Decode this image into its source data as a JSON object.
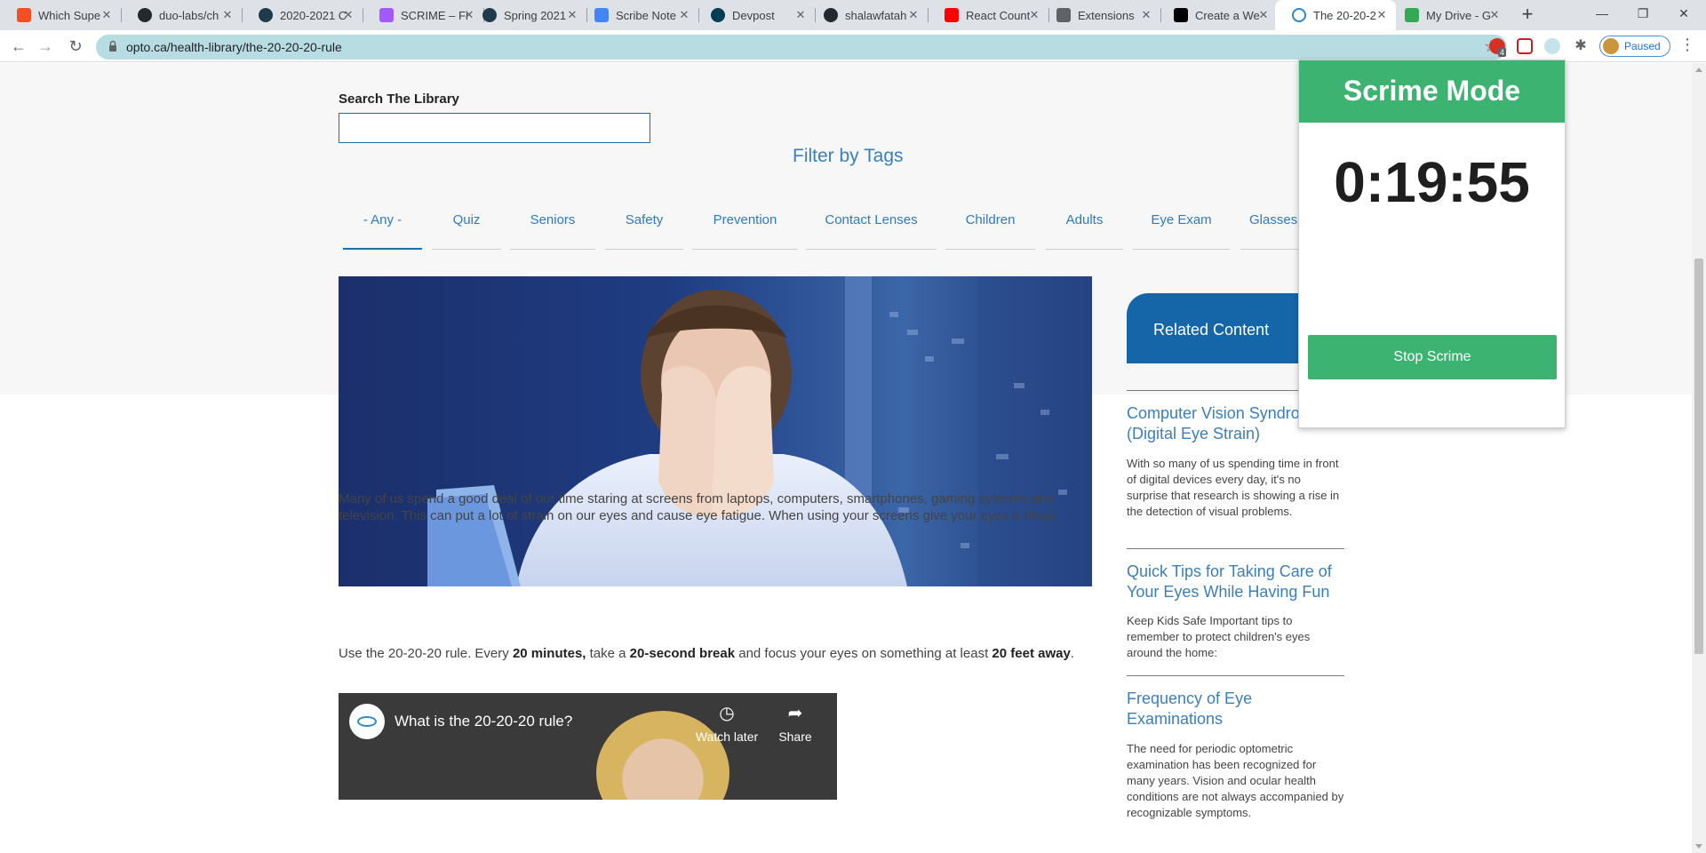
{
  "browser": {
    "tabs": [
      {
        "title": "Which Supe",
        "icon": "microsoft-icon",
        "color": "#f25022"
      },
      {
        "title": "duo-labs/ch",
        "icon": "github-icon",
        "color": "#24292e"
      },
      {
        "title": "2020-2021 C",
        "icon": "generic-dark-icon",
        "color": "#1e3a4c"
      },
      {
        "title": "SCRIME – Fi",
        "icon": "figma-icon",
        "color": "#a259ff"
      },
      {
        "title": "Spring 2021",
        "icon": "generic-dark-icon",
        "color": "#1e3a4c"
      },
      {
        "title": "Scribe Note",
        "icon": "google-docs-icon",
        "color": "#4285f4"
      },
      {
        "title": "Devpost",
        "icon": "devpost-icon",
        "color": "#003e54"
      },
      {
        "title": "shalawfatah",
        "icon": "github-icon",
        "color": "#24292e"
      },
      {
        "title": "React Count",
        "icon": "youtube-icon",
        "color": "#ff0000"
      },
      {
        "title": "Extensions",
        "icon": "puzzle-icon",
        "color": "#5f6368"
      },
      {
        "title": "Create a We",
        "icon": "dev-icon",
        "color": "#000000"
      },
      {
        "title": "The 20-20-2",
        "icon": "eye-icon",
        "color": "#2f88c7"
      },
      {
        "title": "My Drive - G",
        "icon": "google-drive-icon",
        "color": "#34a853"
      }
    ],
    "url": "opto.ca/health-library/the-20-20-20-rule",
    "profile_label": "Paused",
    "extension_badge": "4"
  },
  "page": {
    "search_label": "Search The Library",
    "filter_title": "Filter by Tags",
    "tags": [
      "- Any -",
      "Quiz",
      "Seniors",
      "Safety",
      "Prevention",
      "Contact Lenses",
      "Children",
      "Adults",
      "Eye Exam",
      "Glasses"
    ],
    "intro": "Many of us spend a good deal of our time staring at screens from laptops, computers, smartphones, gaming systems and television. This can put a lot of strain on our eyes and cause eye fatigue. When using your screens give your eyes a break.",
    "rule_parts": {
      "p1": "Use the 20-20-20 rule. Every ",
      "b1": "20 minutes,",
      "p2": " take a ",
      "b2": "20-second break",
      "p3": " and focus your eyes on something at least ",
      "b3": "20 feet away",
      "p4": "."
    },
    "video": {
      "title": "What is the 20-20-20 rule?",
      "watch_later": "Watch later",
      "share": "Share"
    },
    "related": {
      "heading": "Related Content",
      "items": [
        {
          "title": "Computer Vision Syndrome (Digital Eye Strain)",
          "text": "With so many of us spending time in front of digital devices every day, it's no surprise that research is showing a rise in the detection of visual problems."
        },
        {
          "title": "Quick Tips for Taking Care of Your Eyes While Having Fun",
          "text": "Keep Kids Safe  Important tips to remember to protect children's eyes around the home:"
        },
        {
          "title": "Frequency of Eye Examinations",
          "text": "The need for periodic optometric examination has been recognized for many years. Vision and ocular health conditions are not always accompanied by recognizable symptoms."
        }
      ]
    }
  },
  "popup": {
    "title": "Scrime Mode",
    "timer": "0:19:55",
    "stop_label": "Stop Scrime"
  },
  "colors": {
    "accent_green": "#3cb371",
    "link_blue": "#3c7fb8",
    "related_blue": "#1566a8"
  }
}
